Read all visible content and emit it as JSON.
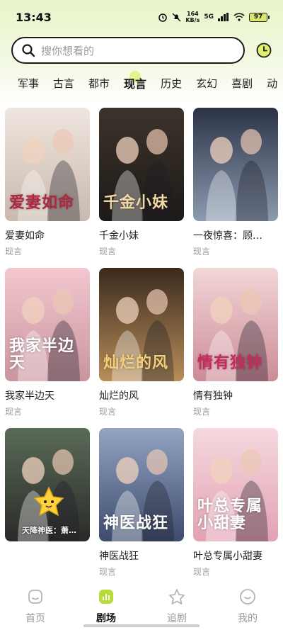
{
  "status_bar": {
    "time": "13:43",
    "net_speed_value": "164",
    "net_speed_unit": "KB/s",
    "network": "5G",
    "battery": "97"
  },
  "search": {
    "placeholder": "搜你想看的",
    "search_icon": "search-icon",
    "history_icon": "clock-icon"
  },
  "categories": {
    "items": [
      "军事",
      "古言",
      "都市",
      "现言",
      "历史",
      "玄幻",
      "喜剧",
      "动"
    ],
    "active": "现言"
  },
  "cards": [
    {
      "title": "爱妻如命",
      "tag": "现言",
      "poster_title": "爱妻如命",
      "colors": [
        "#efe6df",
        "#c9b9ae"
      ],
      "title_color": "#b0263e"
    },
    {
      "title": "千金小妹",
      "tag": "现言",
      "poster_title": "千金小妹",
      "colors": [
        "#3c332b",
        "#1e1a17"
      ],
      "title_color": "#f3d9a3"
    },
    {
      "title": "一夜惊喜：顾…",
      "tag": "现言",
      "poster_title": "",
      "colors": [
        "#2c3347",
        "#8c9bb1"
      ],
      "title_color": "#ffffff"
    },
    {
      "title": "我家半边天",
      "tag": "现言",
      "poster_title": "我家半边天",
      "colors": [
        "#f3c7cf",
        "#c9959f"
      ],
      "title_color": "#ffffff"
    },
    {
      "title": "灿烂的风",
      "tag": "现言",
      "poster_title": "灿烂的风",
      "colors": [
        "#3a2a1c",
        "#b88e5a"
      ],
      "title_color": "#f3cf7a"
    },
    {
      "title": "情有独钟",
      "tag": "现言",
      "poster_title": "情有独钟",
      "colors": [
        "#f2d6d8",
        "#cc8c96"
      ],
      "title_color": "#c92a5b"
    },
    {
      "title": "",
      "tag": "",
      "poster_title": "",
      "overlay": "天降神医：萧…",
      "colors": [
        "#5a6b58",
        "#2a2a28"
      ],
      "title_color": "#ffffff"
    },
    {
      "title": "神医战狂",
      "tag": "现言",
      "poster_title": "神医战狂",
      "colors": [
        "#93a3c2",
        "#3d4c6d"
      ],
      "title_color": "#ffffff"
    },
    {
      "title": "叶总专属小甜妻",
      "tag": "现言",
      "poster_title": "叶总专属小甜妻",
      "colors": [
        "#f5d9df",
        "#e2a2b3"
      ],
      "title_color": "#ffffff"
    }
  ],
  "bottom_nav": [
    {
      "label": "首页",
      "icon": "home-icon",
      "active": false
    },
    {
      "label": "剧场",
      "icon": "theater-icon",
      "active": true
    },
    {
      "label": "追剧",
      "icon": "star-icon",
      "active": false
    },
    {
      "label": "我的",
      "icon": "profile-icon",
      "active": false
    }
  ]
}
